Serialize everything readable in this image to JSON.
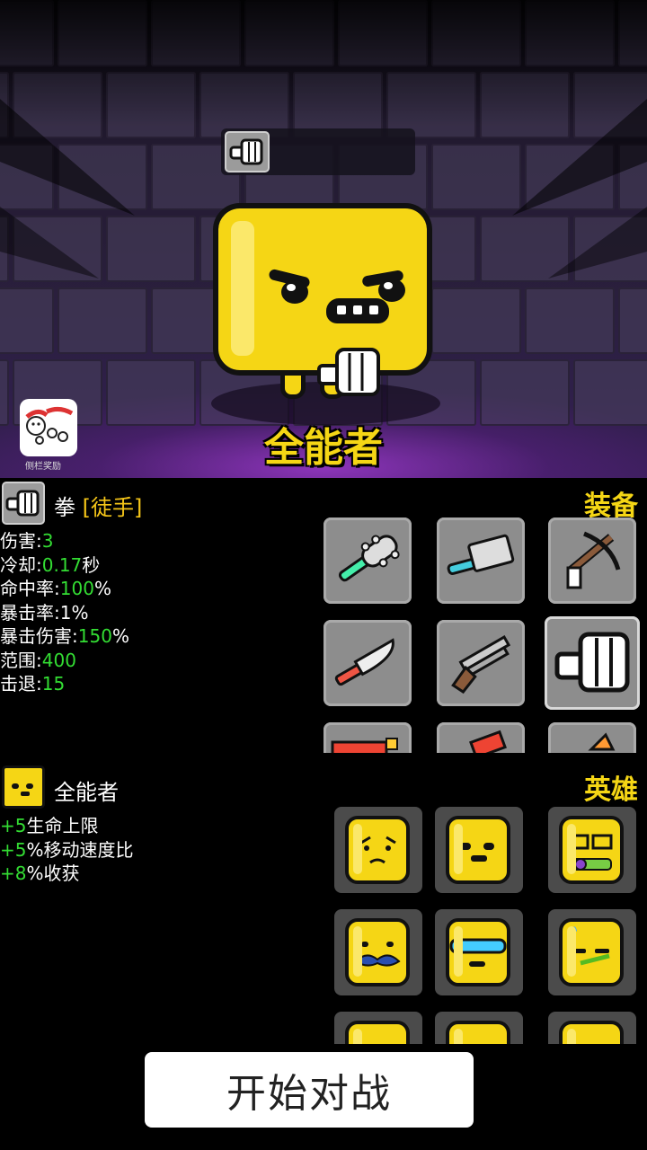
{
  "scene": {
    "hero_name": "全能者",
    "sidebar_reward_label": "侧栏奖励"
  },
  "weapon_panel": {
    "name": "拳",
    "subtype": "[徒手]",
    "tab_label": "装备",
    "stats": [
      {
        "label": "伤害:",
        "value": "3",
        "unit": ""
      },
      {
        "label": "冷却:",
        "value": "0.17",
        "unit": "秒"
      },
      {
        "label": "命中率:",
        "value": "100",
        "unit": "%"
      },
      {
        "label": "暴击率:",
        "value": "",
        "unit": "1%"
      },
      {
        "label": "暴击伤害:",
        "value": "150",
        "unit": "%"
      },
      {
        "label": "范围:",
        "value": "400",
        "unit": ""
      },
      {
        "label": "击退:",
        "value": "15",
        "unit": ""
      }
    ],
    "items": [
      {
        "icon": "spiked-club-icon"
      },
      {
        "icon": "cleaver-icon"
      },
      {
        "icon": "crossbow-icon"
      },
      {
        "icon": "knife-icon"
      },
      {
        "icon": "shotgun-icon"
      },
      {
        "icon": "fist-icon",
        "selected": true
      },
      {
        "icon": "red-weapon-icon"
      },
      {
        "icon": "red-weapon-icon"
      },
      {
        "icon": "orange-weapon-icon"
      }
    ]
  },
  "hero_panel": {
    "name": "全能者",
    "tab_label": "英雄",
    "bonuses": [
      {
        "value": "+5",
        "text": "生命上限"
      },
      {
        "value": "+5",
        "text": "%移动速度比"
      },
      {
        "value": "+8",
        "text": "%收获"
      }
    ],
    "heroes": [
      {
        "icon": "sad-hero-icon"
      },
      {
        "icon": "grumpy-hero-icon"
      },
      {
        "icon": "glasses-hero-icon"
      },
      {
        "icon": "mustache-hero-icon"
      },
      {
        "icon": "visor-hero-icon"
      },
      {
        "icon": "sweat-hero-icon"
      },
      {
        "icon": "hero-icon"
      },
      {
        "icon": "hero-icon"
      },
      {
        "icon": "hero-icon"
      }
    ]
  },
  "start_button": "开始对战",
  "colors": {
    "accent_yellow": "#f5d615",
    "stat_green": "#33dd33",
    "subtype_gold": "#f5c518"
  }
}
